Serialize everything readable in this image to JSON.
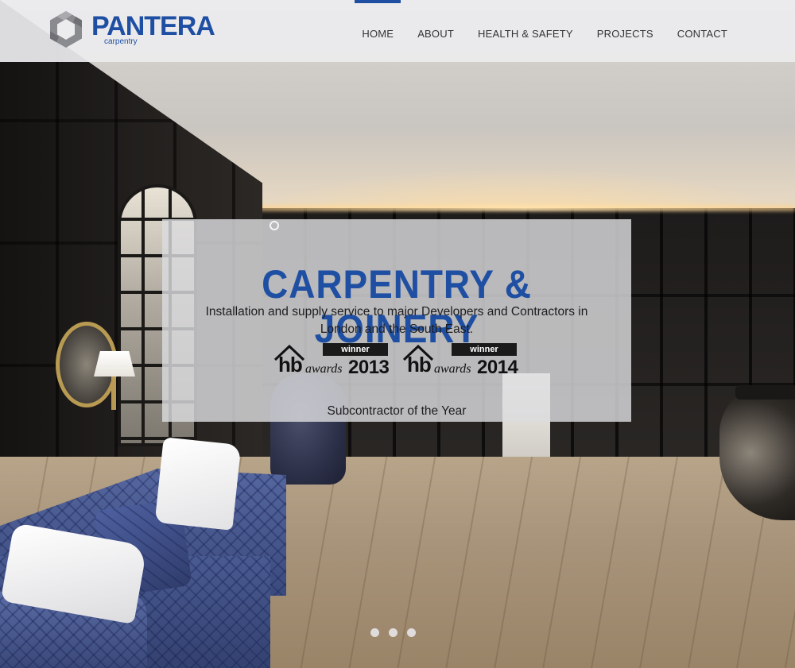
{
  "brand": {
    "name": "PANTERA",
    "tagline": "carpentry",
    "color": "#1f4fa3"
  },
  "nav": {
    "items": [
      {
        "label": "HOME",
        "active": true
      },
      {
        "label": "ABOUT",
        "active": false
      },
      {
        "label": "HEALTH & SAFETY",
        "active": false
      },
      {
        "label": "PROJECTS",
        "active": false
      },
      {
        "label": "CONTACT",
        "active": false
      }
    ]
  },
  "hero": {
    "title": "CARPENTRY & JOINERY",
    "description": "Installation and supply service to major Developers and Contractors in London and the South East.",
    "awards": [
      {
        "badge": "winner",
        "brand": "hb",
        "word": "awards",
        "year": "2013"
      },
      {
        "badge": "winner",
        "brand": "hb",
        "word": "awards",
        "year": "2014"
      }
    ],
    "caption": "Subcontractor of the Year"
  },
  "slider": {
    "total": 3,
    "active_index": 0
  },
  "colors": {
    "accent": "#1f4fa3",
    "header_bg": "#ececee",
    "panel_bg": "#dcdcde"
  }
}
